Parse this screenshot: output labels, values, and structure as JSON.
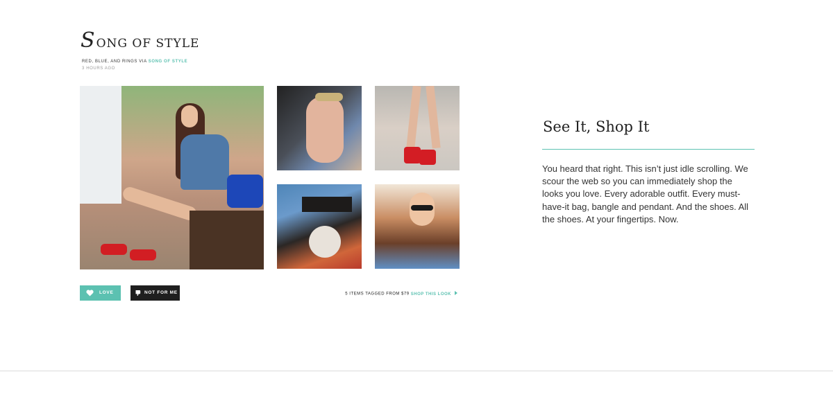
{
  "post": {
    "brand": {
      "initial": "S",
      "rest": "ONG OF STYLE"
    },
    "caption_prefix": "RED, BLUE, AND RINGS VIA",
    "caption_source": "SONG OF STYLE",
    "time": "3 HOURS AGO",
    "images": [
      {
        "name": "woman-on-bench-photo"
      },
      {
        "name": "hand-with-rings-photo"
      },
      {
        "name": "red-sandals-photo"
      },
      {
        "name": "graphic-tee-photo"
      },
      {
        "name": "portrait-sunglasses-photo"
      }
    ]
  },
  "actions": {
    "love_label": "LOVE",
    "love_icon": "heart-icon",
    "not_label": "NOT FOR ME",
    "not_icon": "thumbs-down-icon",
    "tagged_text": "5 ITEMS TAGGED FROM $79",
    "shop_label": "SHOP THIS LOOK",
    "shop_icon": "arrow-right-icon"
  },
  "promo": {
    "title": "See It, Shop It",
    "body": "You heard that right. This isn’t just idle scrolling. We scour the web so you can immediately shop the looks you love. Every adorable outfit. Every must-have-it bag, bangle and pendant. And the shoes. All the shoes. At your fingertips. Now."
  },
  "colors": {
    "accent": "#5cc1b1",
    "dark_button": "#1f1f1f",
    "text": "#222222"
  }
}
